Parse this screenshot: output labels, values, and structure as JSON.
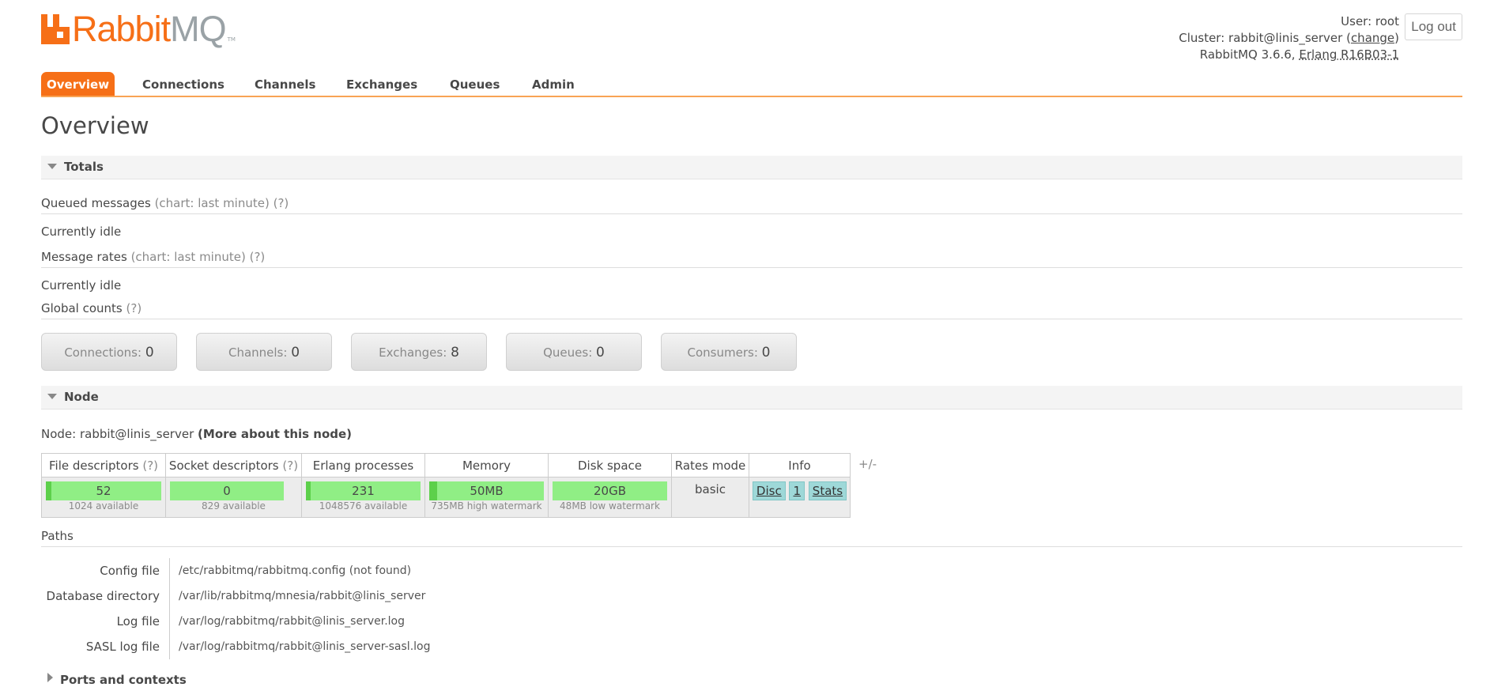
{
  "header": {
    "logo_rabbit": "Rabbit",
    "logo_mq": "MQ",
    "logo_tm": "TM",
    "user_label": "User:",
    "user_name": "root",
    "cluster_label": "Cluster:",
    "cluster_name": "rabbit@linis_server",
    "cluster_change": "change",
    "version": "RabbitMQ 3.6.6,",
    "erlang": "Erlang R16B03-1",
    "logout_label": "Log out"
  },
  "tabs": [
    {
      "label": "Overview",
      "active": true
    },
    {
      "label": "Connections"
    },
    {
      "label": "Channels"
    },
    {
      "label": "Exchanges"
    },
    {
      "label": "Queues"
    },
    {
      "label": "Admin"
    }
  ],
  "page_title": "Overview",
  "totals": {
    "section_label": "Totals",
    "queued_label": "Queued messages",
    "queued_chart": "(chart: last minute)",
    "help": "(?)",
    "idle_1": "Currently idle",
    "rates_label": "Message rates",
    "rates_chart": "(chart: last minute)",
    "idle_2": "Currently idle",
    "global_label": "Global counts",
    "counts": [
      {
        "label": "Connections:",
        "value": "0"
      },
      {
        "label": "Channels:",
        "value": "0"
      },
      {
        "label": "Exchanges:",
        "value": "8"
      },
      {
        "label": "Queues:",
        "value": "0"
      },
      {
        "label": "Consumers:",
        "value": "0"
      }
    ]
  },
  "node": {
    "section_label": "Node",
    "node_label": "Node:",
    "node_name": "rabbit@linis_server",
    "more_link": "(More about this node)",
    "columns": [
      "File descriptors",
      "Socket descriptors",
      "Erlang processes",
      "Memory",
      "Disk space",
      "Rates mode",
      "Info"
    ],
    "help": "(?)",
    "file_desc": {
      "value": "52",
      "sub": "1024 available",
      "fraction": 0.051
    },
    "socket_desc": {
      "value": "0",
      "sub": "829 available",
      "fraction": 0
    },
    "erlang_proc": {
      "value": "231",
      "sub": "1048576 available",
      "fraction": 0.0002
    },
    "memory": {
      "value": "50MB",
      "sub": "735MB high watermark",
      "fraction": 0.068
    },
    "disk": {
      "value": "20GB",
      "sub": "48MB low watermark",
      "fraction": 0
    },
    "rates_mode": "basic",
    "info_tags": [
      "Disc",
      "1",
      "Stats"
    ],
    "plus_minus": "+/-"
  },
  "paths": {
    "label": "Paths",
    "rows": [
      {
        "name": "Config file",
        "value": "/etc/rabbitmq/rabbitmq.config (not found)"
      },
      {
        "name": "Database directory",
        "value": "/var/lib/rabbitmq/mnesia/rabbit@linis_server"
      },
      {
        "name": "Log file",
        "value": "/var/log/rabbitmq/rabbit@linis_server.log"
      },
      {
        "name": "SASL log file",
        "value": "/var/log/rabbitmq/rabbit@linis_server-sasl.log"
      }
    ]
  },
  "ports": {
    "section_label": "Ports and contexts"
  },
  "colors": {
    "brand_orange": "#f66f17",
    "bar_green": "#90ee85",
    "info_teal": "#9ed8d8"
  }
}
